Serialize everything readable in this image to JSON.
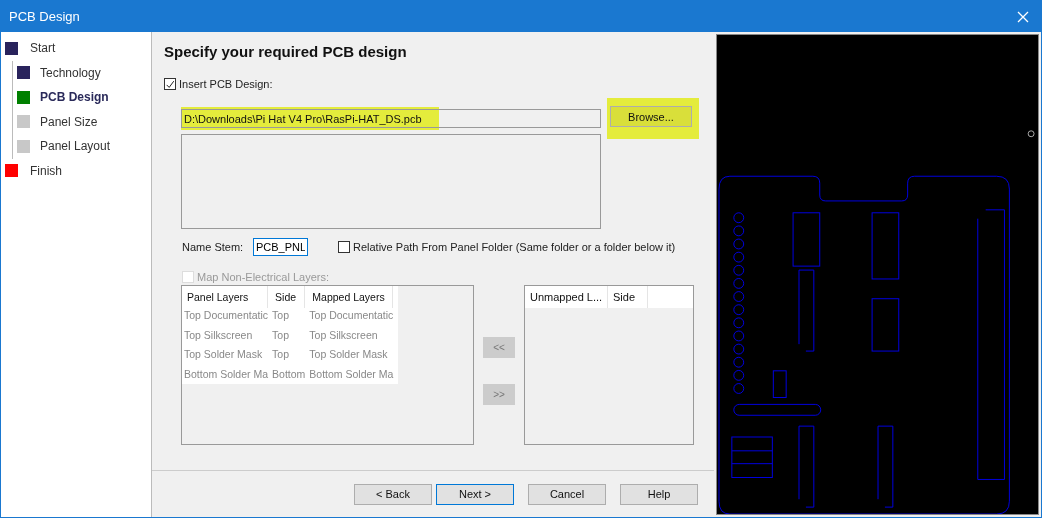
{
  "window": {
    "title": "PCB Design"
  },
  "steps": [
    {
      "label": "Start",
      "color": "#29235c",
      "selected": false,
      "children": [
        {
          "label": "Technology",
          "color": "#29235c",
          "selected": false
        },
        {
          "label": "PCB Design",
          "color": "#008000",
          "selected": true
        },
        {
          "label": "Panel Size",
          "color": "#c8c8c8",
          "selected": false
        },
        {
          "label": "Panel Layout",
          "color": "#c8c8c8",
          "selected": false
        }
      ]
    },
    {
      "label": "Finish",
      "color": "#ff0000",
      "selected": false
    }
  ],
  "heading": "Specify your required PCB design",
  "insert_design": {
    "label": "Insert PCB Design:",
    "checked": true
  },
  "path_field": {
    "value": "D:\\Downloads\\Pi Hat V4 Pro\\RasPi-HAT_DS.pcb",
    "highlighted": true
  },
  "browse_button": {
    "label": "Browse...",
    "highlighted": true
  },
  "name_stem": {
    "label": "Name Stem:",
    "value": "PCB_PNL"
  },
  "relative_path": {
    "label": "Relative Path From Panel Folder (Same folder or a folder below it)",
    "checked": false
  },
  "map_layers": {
    "label": "Map Non-Electrical Layers:",
    "checked": false,
    "disabled": true
  },
  "layers_table": {
    "disabled": true,
    "columns": [
      "Panel Layers",
      "Side",
      "Mapped Layers"
    ],
    "rows": [
      [
        "Top Documentatic",
        "Top",
        "Top Documentatic"
      ],
      [
        "Top Silkscreen",
        "Top",
        "Top Silkscreen"
      ],
      [
        "Top Solder Mask",
        "Top",
        "Top Solder Mask"
      ],
      [
        "Bottom Solder Ma",
        "Bottom",
        "Bottom Solder Ma"
      ]
    ]
  },
  "move_buttons": [
    "<<",
    ">>"
  ],
  "unmapped_table": {
    "columns": [
      "Unmapped L...",
      "Side"
    ]
  },
  "buttons": [
    {
      "label": "< Back",
      "selected": false
    },
    {
      "label": "Next >",
      "selected": true
    },
    {
      "label": "Cancel",
      "selected": false
    },
    {
      "label": "Help",
      "selected": false
    }
  ]
}
